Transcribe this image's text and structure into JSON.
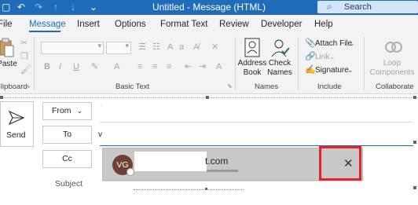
{
  "titlebar": {
    "title": "Untitled - Message (HTML)",
    "search_label": "Search"
  },
  "tabs": [
    {
      "label": "File",
      "active": false
    },
    {
      "label": "Message",
      "active": true
    },
    {
      "label": "Insert",
      "active": false
    },
    {
      "label": "Options",
      "active": false
    },
    {
      "label": "Format Text",
      "active": false
    },
    {
      "label": "Review",
      "active": false
    },
    {
      "label": "Developer",
      "active": false
    },
    {
      "label": "Help",
      "active": false
    }
  ],
  "ribbon": {
    "groups": {
      "clipboard": "Clipboard",
      "basic_text": "Basic Text",
      "names": "Names",
      "include": "Include",
      "collaborate": "Collaborate"
    },
    "paste_label": "Paste",
    "address_book": [
      "Address",
      "Book"
    ],
    "check_names": [
      "Check",
      "Names"
    ],
    "attach_file": "Attach File",
    "link": "Link",
    "signature": "Signature",
    "loop_components": [
      "Loop",
      "Components"
    ]
  },
  "compose": {
    "send_label": "Send",
    "from_label": "From",
    "to_label": "To",
    "cc_label": "Cc",
    "subject_label": "Subject",
    "to_value": "v",
    "suggestion": {
      "initials": "VG",
      "email_visible_tail": "t.com"
    }
  },
  "colors": {
    "accent": "#1f6cb9",
    "highlight": "#e0242a",
    "avatar": "#6e4133"
  }
}
